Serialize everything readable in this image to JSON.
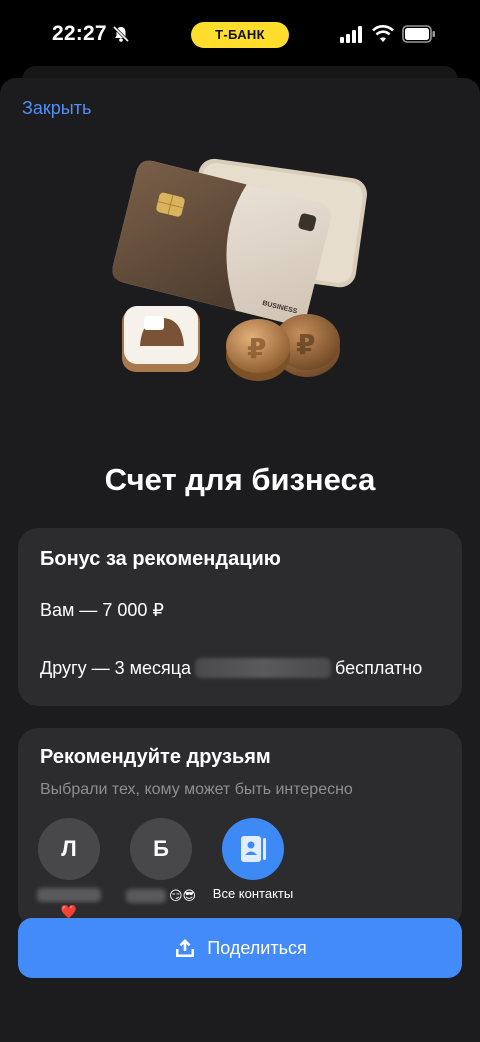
{
  "status_bar": {
    "time": "22:27",
    "bank_pill": "Т-БАНК",
    "icons": [
      "bell-muted-icon",
      "signal-icon",
      "wifi-icon",
      "battery-icon"
    ]
  },
  "sheet": {
    "close_label": "Закрыть",
    "title": "Счет для бизнеса"
  },
  "hero": {
    "card_label": "BUSINESS"
  },
  "bonus": {
    "title": "Бонус за рекомендацию",
    "line1": "Вам — 7 000 ₽",
    "line2_prefix": "Другу — 3 месяца",
    "line2_suffix": "бесплатно"
  },
  "recommend": {
    "title": "Рекомендуйте друзьям",
    "subtitle": "Выбрали тех, кому может быть интересно",
    "contacts": [
      {
        "initial": "Л",
        "emoji": "❤️"
      },
      {
        "initial": "Б",
        "emoji": "😏😎"
      }
    ],
    "all_contacts_label": "Все контакты"
  },
  "share": {
    "label": "Поделиться"
  },
  "colors": {
    "accent": "#428bf9",
    "link": "#4f8ff7",
    "pill": "#ffdd2d",
    "card_bg": "#2c2c2e",
    "sheet_bg": "#1c1c1e"
  }
}
